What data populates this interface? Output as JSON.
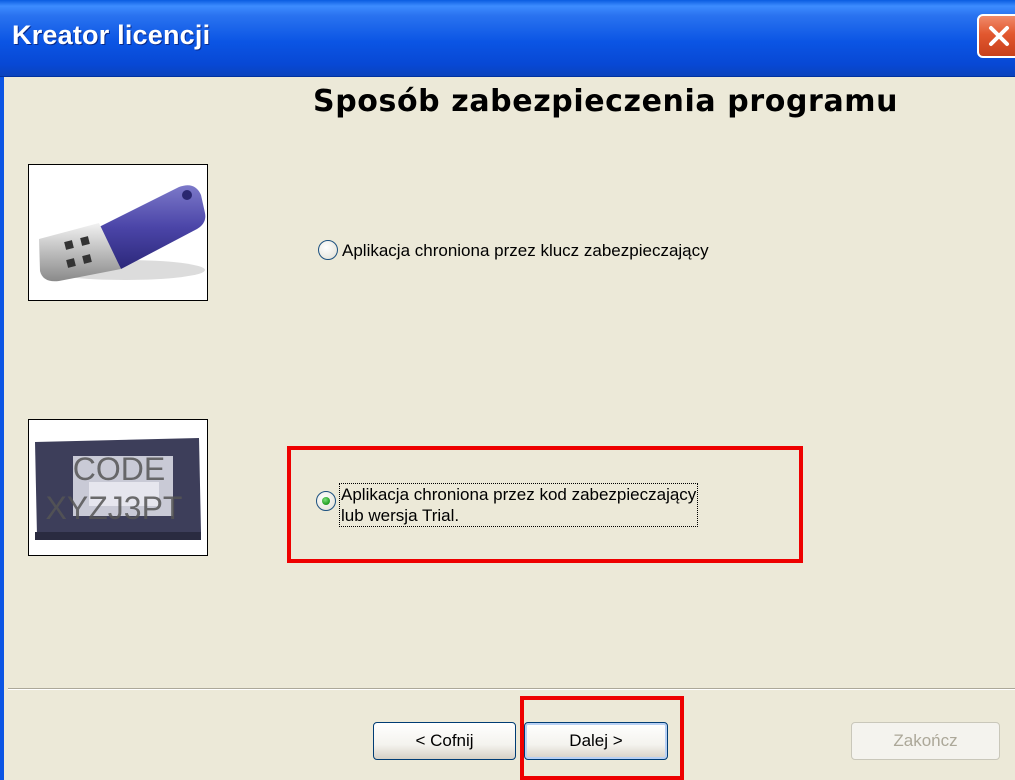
{
  "window": {
    "title": "Kreator licencji"
  },
  "page": {
    "heading": "Sposób zabezpieczenia programu"
  },
  "options": [
    {
      "label": "Aplikacja chroniona przez klucz zabezpieczający",
      "checked": false
    },
    {
      "label_line1": "Aplikacja chroniona przez kod zabezpieczający",
      "label_line2": "lub wersja Trial.",
      "checked": true
    }
  ],
  "code_image": {
    "line1": "CODE",
    "line2": "XYZJ3PT"
  },
  "buttons": {
    "back": "< Cofnij",
    "next": "Dalej >",
    "finish": "Zakończ"
  },
  "colors": {
    "title_bar": "#0b55e4",
    "highlight": "#ee0000",
    "background": "#ece9d8"
  }
}
